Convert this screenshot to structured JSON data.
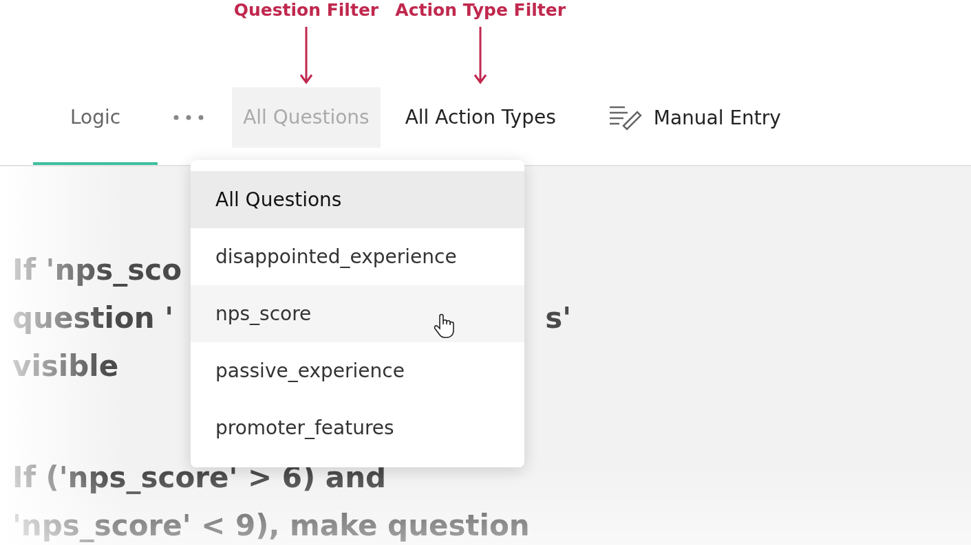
{
  "toolbar": [
    {
      "kind": "tab",
      "label": "Logic",
      "selected": true
    },
    {
      "kind": "more"
    },
    {
      "kind": "filter",
      "label": "All Questions",
      "open": true,
      "annotation": "Question Filter"
    },
    {
      "kind": "filter",
      "label": "All Action Types",
      "open": false,
      "annotation": "Action Type Filter"
    },
    {
      "kind": "action",
      "label": "Manual Entry"
    }
  ],
  "dropdown": {
    "items": [
      {
        "label": "All Questions",
        "selected": true,
        "hovered": false
      },
      {
        "label": "disappointed_experience",
        "selected": false,
        "hovered": false
      },
      {
        "label": "nps_score",
        "selected": false,
        "hovered": true
      },
      {
        "label": "passive_experience",
        "selected": false,
        "hovered": false
      },
      {
        "label": "promoter_features",
        "selected": false,
        "hovered": false
      }
    ]
  },
  "rules": [
    {
      "lines": [
        [
          "If 'nps_sco"
        ],
        [
          "question '",
          "s'"
        ],
        [
          "visible"
        ]
      ]
    },
    {
      "lines": [
        [
          "If ('nps_score' > 6) and"
        ],
        [
          "'nps_score' < 9), make question"
        ]
      ]
    }
  ]
}
